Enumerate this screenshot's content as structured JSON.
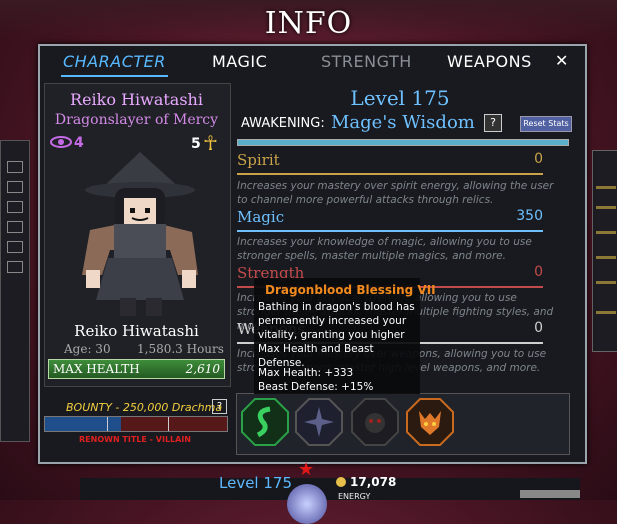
{
  "screen_title": "INFO",
  "tabs": [
    {
      "label": "CHARACTER",
      "active": true
    },
    {
      "label": "MAGIC",
      "active": false
    },
    {
      "label": "STRENGTH",
      "active": false
    },
    {
      "label": "WEAPONS",
      "active": false
    }
  ],
  "close_label": "✕",
  "character": {
    "name": "Reiko Hiwatashi",
    "title": "Dragonslayer of Mercy",
    "eye_count": "4",
    "ankh_count": "5",
    "display_name": "Reiko Hiwatashi",
    "age": "Age: 30",
    "hours": "1,580.3 Hours",
    "max_health_label": "MAX HEALTH",
    "max_health_value": "2,610"
  },
  "bounty": {
    "label": "BOUNTY - 250,000 Drachma",
    "help": "?",
    "fill_fraction": 0.42,
    "renown": "RENOWN TITLE - VILLAIN"
  },
  "level_label": "Level 175",
  "awakening": {
    "label": "AWAKENING:",
    "value": "Mage's Wisdom",
    "help": "?"
  },
  "reset_label": "Reset Stats",
  "stats": [
    {
      "name": "Spirit",
      "value": "0",
      "color": "#c9a24a",
      "desc": "Increases your mastery over spirit energy, allowing the user to channel more powerful attacks through relics."
    },
    {
      "name": "Magic",
      "value": "350",
      "color": "#6fc0ff",
      "desc": "Increases your knowledge of magic, allowing you to use stronger spells, master multiple magics, and more."
    },
    {
      "name": "Strength",
      "value": "0",
      "color": "#c44b4b",
      "desc": "Increases your physical strength, allowing you to use stronger melee attacks, master multiple fighting styles, and more."
    },
    {
      "name": "Weapons",
      "value": "0",
      "color": "#cfcfcf",
      "desc": "Increases your mastery over weapons, allowing you to use stronger weapons, master high level weapons, and more."
    }
  ],
  "tooltip": {
    "title": "Dragonblood Blessing VII",
    "description": "Bathing in dragon's blood has permanently increased your vitality, granting you higher Max Health and Beast Defense.",
    "stat1": "Max Health: +333",
    "stat2": "Beast Defense: +15%"
  },
  "hud": {
    "level": "Level 175",
    "gold": "17,078",
    "energy_label": "ENERGY"
  }
}
